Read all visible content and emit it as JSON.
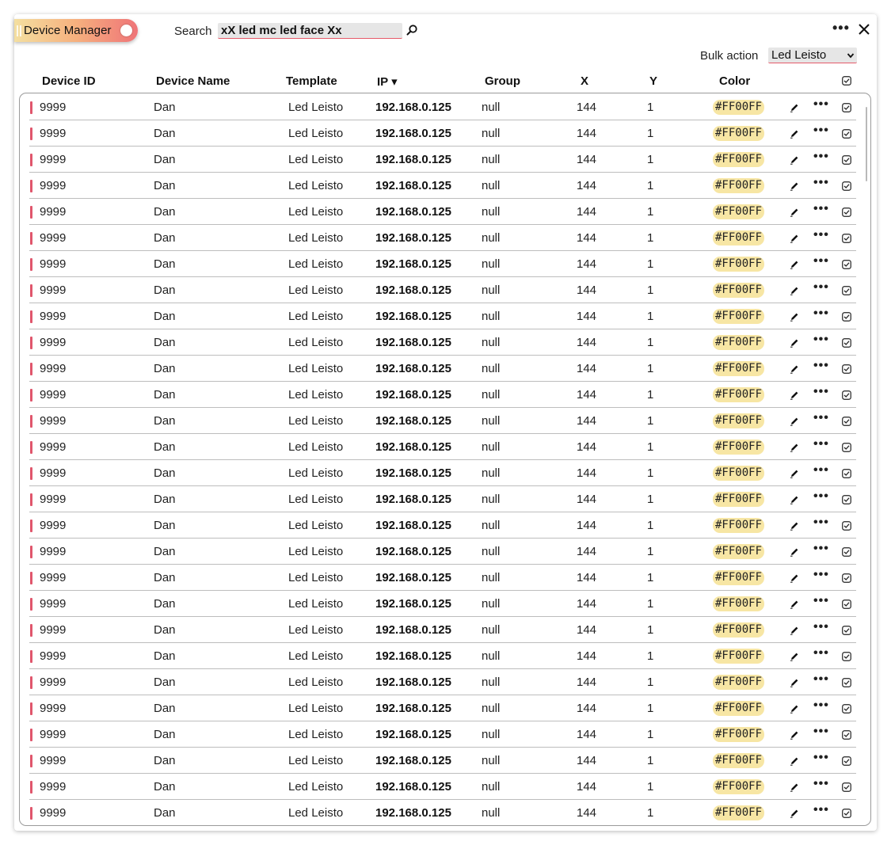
{
  "app": {
    "title": "Device Manager"
  },
  "search": {
    "label": "Search",
    "value": "xX led mc led face Xx"
  },
  "toolbar": {
    "more_icon": "ellipsis-icon",
    "close_icon": "close-icon"
  },
  "bulk": {
    "label": "Bulk action",
    "selected": "Led Leisto"
  },
  "columns": {
    "device_id": "Device ID",
    "device_name": "Device Name",
    "template": "Template",
    "ip": "IP ▾",
    "group": "Group",
    "x": "X",
    "y": "Y",
    "color": "Color"
  },
  "theme": {
    "accent": "#e0566c",
    "color_chip": "#f7e6a4"
  },
  "rows": [
    {
      "id": "9999",
      "name": "Dan",
      "template": "Led Leisto",
      "ip": "192.168.0.125",
      "group": "null",
      "x": "144",
      "y": "1",
      "color": "#FF00FF"
    },
    {
      "id": "9999",
      "name": "Dan",
      "template": "Led Leisto",
      "ip": "192.168.0.125",
      "group": "null",
      "x": "144",
      "y": "1",
      "color": "#FF00FF"
    },
    {
      "id": "9999",
      "name": "Dan",
      "template": "Led Leisto",
      "ip": "192.168.0.125",
      "group": "null",
      "x": "144",
      "y": "1",
      "color": "#FF00FF"
    },
    {
      "id": "9999",
      "name": "Dan",
      "template": "Led Leisto",
      "ip": "192.168.0.125",
      "group": "null",
      "x": "144",
      "y": "1",
      "color": "#FF00FF"
    },
    {
      "id": "9999",
      "name": "Dan",
      "template": "Led Leisto",
      "ip": "192.168.0.125",
      "group": "null",
      "x": "144",
      "y": "1",
      "color": "#FF00FF"
    },
    {
      "id": "9999",
      "name": "Dan",
      "template": "Led Leisto",
      "ip": "192.168.0.125",
      "group": "null",
      "x": "144",
      "y": "1",
      "color": "#FF00FF"
    },
    {
      "id": "9999",
      "name": "Dan",
      "template": "Led Leisto",
      "ip": "192.168.0.125",
      "group": "null",
      "x": "144",
      "y": "1",
      "color": "#FF00FF"
    },
    {
      "id": "9999",
      "name": "Dan",
      "template": "Led Leisto",
      "ip": "192.168.0.125",
      "group": "null",
      "x": "144",
      "y": "1",
      "color": "#FF00FF"
    },
    {
      "id": "9999",
      "name": "Dan",
      "template": "Led Leisto",
      "ip": "192.168.0.125",
      "group": "null",
      "x": "144",
      "y": "1",
      "color": "#FF00FF"
    },
    {
      "id": "9999",
      "name": "Dan",
      "template": "Led Leisto",
      "ip": "192.168.0.125",
      "group": "null",
      "x": "144",
      "y": "1",
      "color": "#FF00FF"
    },
    {
      "id": "9999",
      "name": "Dan",
      "template": "Led Leisto",
      "ip": "192.168.0.125",
      "group": "null",
      "x": "144",
      "y": "1",
      "color": "#FF00FF"
    },
    {
      "id": "9999",
      "name": "Dan",
      "template": "Led Leisto",
      "ip": "192.168.0.125",
      "group": "null",
      "x": "144",
      "y": "1",
      "color": "#FF00FF"
    },
    {
      "id": "9999",
      "name": "Dan",
      "template": "Led Leisto",
      "ip": "192.168.0.125",
      "group": "null",
      "x": "144",
      "y": "1",
      "color": "#FF00FF"
    },
    {
      "id": "9999",
      "name": "Dan",
      "template": "Led Leisto",
      "ip": "192.168.0.125",
      "group": "null",
      "x": "144",
      "y": "1",
      "color": "#FF00FF"
    },
    {
      "id": "9999",
      "name": "Dan",
      "template": "Led Leisto",
      "ip": "192.168.0.125",
      "group": "null",
      "x": "144",
      "y": "1",
      "color": "#FF00FF"
    },
    {
      "id": "9999",
      "name": "Dan",
      "template": "Led Leisto",
      "ip": "192.168.0.125",
      "group": "null",
      "x": "144",
      "y": "1",
      "color": "#FF00FF"
    },
    {
      "id": "9999",
      "name": "Dan",
      "template": "Led Leisto",
      "ip": "192.168.0.125",
      "group": "null",
      "x": "144",
      "y": "1",
      "color": "#FF00FF"
    },
    {
      "id": "9999",
      "name": "Dan",
      "template": "Led Leisto",
      "ip": "192.168.0.125",
      "group": "null",
      "x": "144",
      "y": "1",
      "color": "#FF00FF"
    },
    {
      "id": "9999",
      "name": "Dan",
      "template": "Led Leisto",
      "ip": "192.168.0.125",
      "group": "null",
      "x": "144",
      "y": "1",
      "color": "#FF00FF"
    },
    {
      "id": "9999",
      "name": "Dan",
      "template": "Led Leisto",
      "ip": "192.168.0.125",
      "group": "null",
      "x": "144",
      "y": "1",
      "color": "#FF00FF"
    },
    {
      "id": "9999",
      "name": "Dan",
      "template": "Led Leisto",
      "ip": "192.168.0.125",
      "group": "null",
      "x": "144",
      "y": "1",
      "color": "#FF00FF"
    },
    {
      "id": "9999",
      "name": "Dan",
      "template": "Led Leisto",
      "ip": "192.168.0.125",
      "group": "null",
      "x": "144",
      "y": "1",
      "color": "#FF00FF"
    },
    {
      "id": "9999",
      "name": "Dan",
      "template": "Led Leisto",
      "ip": "192.168.0.125",
      "group": "null",
      "x": "144",
      "y": "1",
      "color": "#FF00FF"
    },
    {
      "id": "9999",
      "name": "Dan",
      "template": "Led Leisto",
      "ip": "192.168.0.125",
      "group": "null",
      "x": "144",
      "y": "1",
      "color": "#FF00FF"
    },
    {
      "id": "9999",
      "name": "Dan",
      "template": "Led Leisto",
      "ip": "192.168.0.125",
      "group": "null",
      "x": "144",
      "y": "1",
      "color": "#FF00FF"
    },
    {
      "id": "9999",
      "name": "Dan",
      "template": "Led Leisto",
      "ip": "192.168.0.125",
      "group": "null",
      "x": "144",
      "y": "1",
      "color": "#FF00FF"
    },
    {
      "id": "9999",
      "name": "Dan",
      "template": "Led Leisto",
      "ip": "192.168.0.125",
      "group": "null",
      "x": "144",
      "y": "1",
      "color": "#FF00FF"
    },
    {
      "id": "9999",
      "name": "Dan",
      "template": "Led Leisto",
      "ip": "192.168.0.125",
      "group": "null",
      "x": "144",
      "y": "1",
      "color": "#FF00FF"
    }
  ]
}
